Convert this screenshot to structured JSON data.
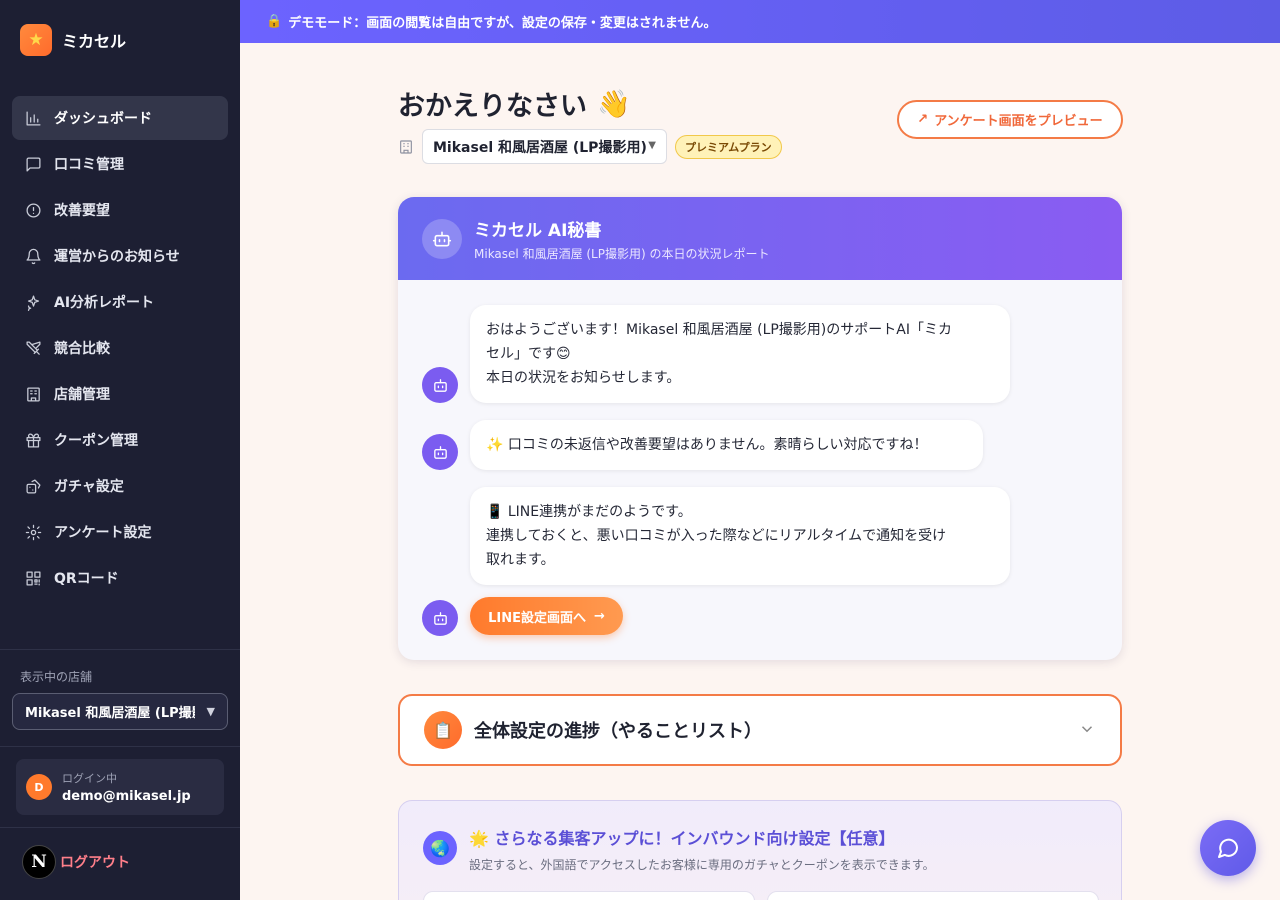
{
  "app": {
    "name": "ミカセル",
    "logo_icon": "star-icon"
  },
  "sidebar": {
    "items": [
      {
        "label": "ダッシュボード",
        "icon": "chart-bar-icon",
        "active": true
      },
      {
        "label": "口コミ管理",
        "icon": "message-square-icon"
      },
      {
        "label": "改善要望",
        "icon": "alert-circle-icon"
      },
      {
        "label": "運営からのお知らせ",
        "icon": "bell-icon"
      },
      {
        "label": "AI分析レポート",
        "icon": "sparkles-icon"
      },
      {
        "label": "競合比較",
        "icon": "swords-icon"
      },
      {
        "label": "店舗管理",
        "icon": "building-icon"
      },
      {
        "label": "クーポン管理",
        "icon": "gift-icon"
      },
      {
        "label": "ガチャ設定",
        "icon": "dice-icon"
      },
      {
        "label": "アンケート設定",
        "icon": "gear-icon"
      },
      {
        "label": "QRコード",
        "icon": "qr-code-icon"
      }
    ],
    "store_label": "表示中の店舗",
    "store_value": "Mikasel 和風居酒屋 (LP撮影",
    "user": {
      "initial": "D",
      "status": "ログイン中",
      "email": "demo@mikasel.jp"
    },
    "logout": "ログアウト",
    "badge_letter": "N"
  },
  "banner": {
    "text": "デモモード：画面の閲覧は自由ですが、設定の保存・変更はされません。"
  },
  "header": {
    "greeting": "おかえりなさい",
    "greeting_emoji": "👋",
    "store_name": "Mikasel 和風居酒屋 (LP撮影用)",
    "plan": "プレミアムプラン",
    "preview_button": "アンケート画面をプレビュー"
  },
  "ai_card": {
    "title": "ミカセル AI秘書",
    "subtitle": "Mikasel 和風居酒屋 (LP撮影用) の本日の状況レポート",
    "messages": [
      {
        "line1": "おはようございます！Mikasel 和風居酒屋 (LP撮影用)のサポートAI「ミカ",
        "line2": "セル」です😊",
        "line3": "本日の状況をお知らせします。"
      },
      {
        "line1": "✨ 口コミの未返信や改善要望はありません。素晴らしい対応ですね！"
      },
      {
        "line1": "📱 LINE連携がまだのようです。",
        "line2": "連携しておくと、悪い口コミが入った際などにリアルタイムで通知を受け",
        "line3": "取れます。"
      }
    ],
    "line_button": "LINE設定画面へ"
  },
  "progress": {
    "title": "全体設定の進捗（やることリスト）",
    "icon": "📋"
  },
  "inbound": {
    "icon": "🌏",
    "title": "🌟 さらなる集客アップに！インバウンド向け設定【任意】",
    "subtitle": "設定すると、外国語でアクセスしたお客様に専用のガチャとクーポンを表示できます。"
  },
  "colors": {
    "accent": "#6c63ff",
    "orange": "#ff7a2c",
    "sidebar_bg": "#1d1f33"
  }
}
